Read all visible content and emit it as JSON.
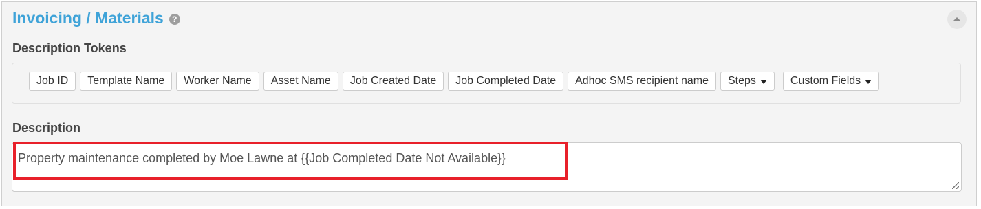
{
  "panel": {
    "title": "Invoicing / Materials",
    "help_icon": "?",
    "collapse_icon": "chevron-up-icon"
  },
  "tokens": {
    "label": "Description Tokens",
    "items": [
      {
        "label": "Job ID"
      },
      {
        "label": "Template Name"
      },
      {
        "label": "Worker Name"
      },
      {
        "label": "Asset Name"
      },
      {
        "label": "Job Created Date"
      },
      {
        "label": "Job Completed Date"
      },
      {
        "label": "Adhoc SMS recipient name"
      },
      {
        "label": "Steps",
        "dropdown": true
      },
      {
        "label": "Custom Fields",
        "dropdown": true
      }
    ]
  },
  "description": {
    "label": "Description",
    "value": "Property maintenance completed by Moe Lawne at {{Job Completed Date Not Available}}"
  },
  "colors": {
    "title": "#3fa3d8",
    "highlight": "#e8202a",
    "panel_bg": "#f4f4f4"
  }
}
